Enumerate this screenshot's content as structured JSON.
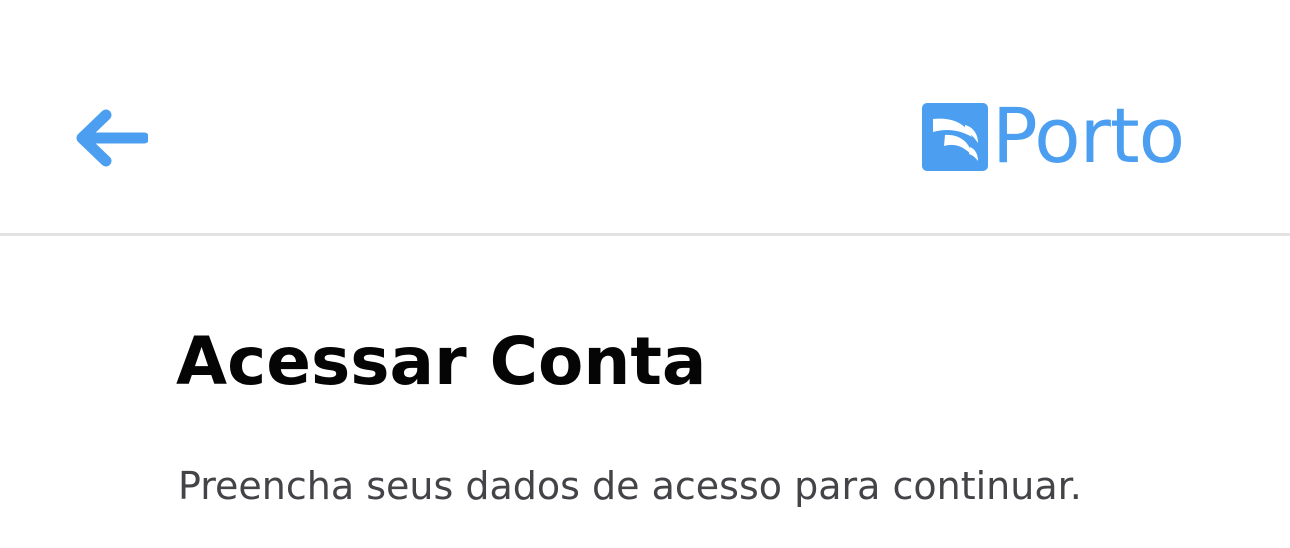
{
  "header": {
    "back": {
      "icon": "arrow-left-icon",
      "color": "#4c9ff0"
    },
    "brand": {
      "logo_icon": "porto-sail-logo-icon",
      "name": "Porto",
      "color": "#4c9ff0"
    }
  },
  "main": {
    "title": "Acessar Conta",
    "subtitle": "Preencha seus dados de acesso para continuar."
  },
  "colors": {
    "accent": "#4c9ff0",
    "background": "#ffffff",
    "divider": "#e3e3e3",
    "title": "#050505",
    "subtitle": "#444448"
  }
}
